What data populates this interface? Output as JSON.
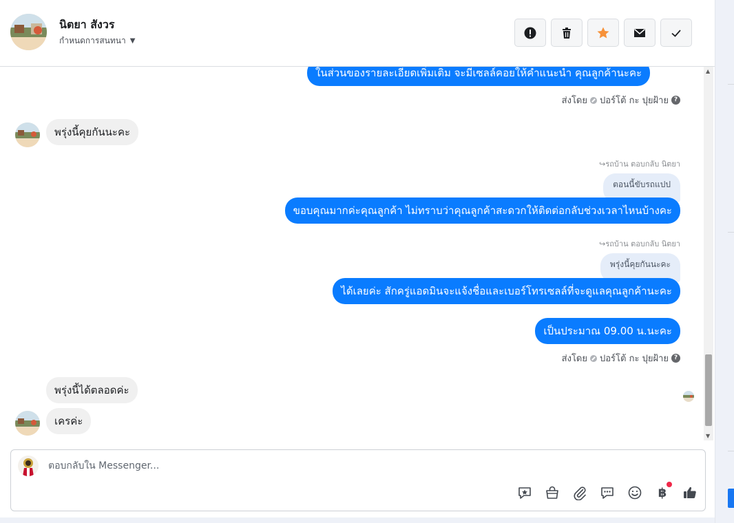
{
  "header": {
    "contact_name": "นิตยา สังวร",
    "conversation_status": "กำหนดการสนทนา",
    "actions": [
      {
        "name": "spam-button",
        "icon": "exclamation-icon"
      },
      {
        "name": "delete-button",
        "icon": "trash-icon"
      },
      {
        "name": "star-button",
        "icon": "star-icon"
      },
      {
        "name": "mark-unread-button",
        "icon": "envelope-icon"
      },
      {
        "name": "done-button",
        "icon": "checkmark-icon"
      }
    ]
  },
  "messages": {
    "m1_text": "ในส่วนของรายละเอียดเพิ่มเติม จะมีเซลล์คอยให้คำแนะนำ คุณลูกค้านะคะ",
    "sent_by_1": "ส่งโดย",
    "sent_by_name_1": "ปอร์โต้ กะ ปุยฝ้าย",
    "m2_text": "พรุ่งนี้คุยกันนะคะ",
    "reply_meta_1": "รถบ้าน ตอบกลับ นิตยา",
    "quote_1": "ตอนนี้ขับรถแปป",
    "m3_text": "ขอบคุณมากค่ะคุณลูกค้า ไม่ทราบว่าคุณลูกค้าสะดวกให้ติดต่อกลับช่วงเวลาไหนบ้างคะ",
    "reply_meta_2": "รถบ้าน ตอบกลับ นิตยา",
    "quote_2": "พรุ่งนี้คุยกันนะคะ",
    "m4_text": "ได้เลยค่ะ สักครู่แอดมินจะแจ้งชื่อและเบอร์โทรเซลล์ที่จะดูแลคุณลูกค้านะคะ",
    "m5_text": "เป็นประมาณ 09.00 น.นะคะ",
    "sent_by_2": "ส่งโดย",
    "sent_by_name_2": "ปอร์โต้ กะ ปุยฝ้าย",
    "m6_text": "พรุ่งนี้ได้ตลอดค่ะ",
    "m7_text": "เครค่ะ"
  },
  "composer": {
    "placeholder": "ตอบกลับใน Messenger...",
    "tools": [
      "saved-reply-icon",
      "shop-icon",
      "attachment-icon",
      "chat-bubble-icon",
      "emoji-icon",
      "baht-icon",
      "thumbs-up-icon"
    ],
    "baht_symbol": "฿"
  },
  "colors": {
    "outgoing_bubble": "#0a7cff",
    "incoming_bubble": "#f0f0f0",
    "quoted_bubble": "#e5edf9",
    "star": "#f7923a",
    "notification_dot": "#f02849"
  }
}
